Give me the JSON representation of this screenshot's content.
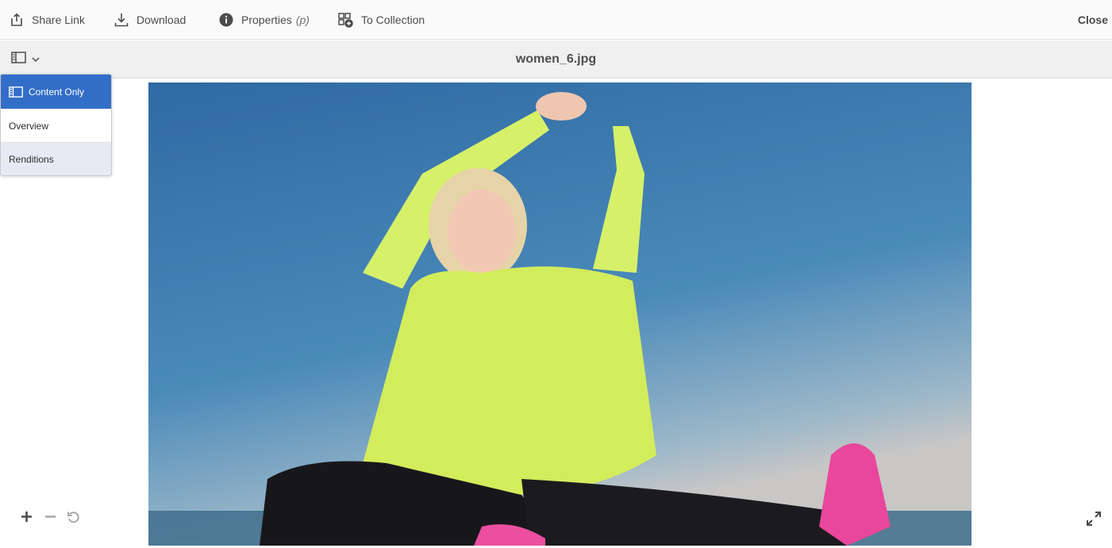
{
  "actionbar": {
    "share_label": "Share Link",
    "download_label": "Download",
    "properties_label": "Properties",
    "properties_hint": "(p)",
    "collection_label": "To Collection",
    "close_label": "Close"
  },
  "titlebar": {
    "title": "women_6.jpg"
  },
  "view_menu": {
    "items": [
      {
        "label": "Content Only"
      },
      {
        "label": "Overview"
      },
      {
        "label": "Renditions"
      }
    ]
  },
  "colors": {
    "accent": "#326ec8",
    "menu_hover": "#e5ebf5"
  },
  "icons": [
    "share-icon",
    "download-icon",
    "info-icon",
    "add-to-collection-icon",
    "rail-toggle-icon",
    "chevron-down-icon",
    "zoom-in-icon",
    "zoom-out-icon",
    "reset-zoom-icon",
    "fullscreen-icon"
  ]
}
